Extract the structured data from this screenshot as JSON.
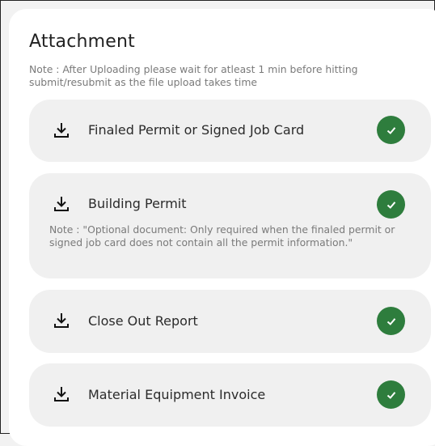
{
  "page": {
    "title": "Attachment",
    "note": "Note : After Uploading please wait for atleast 1 min before hitting submit/resubmit as the file upload takes time"
  },
  "attachments": [
    {
      "label": "Finaled Permit or Signed Job Card",
      "icon": "download-icon",
      "status_icon": "check-icon",
      "status_color": "#2e7d3d"
    },
    {
      "label": "Building Permit",
      "icon": "download-icon",
      "status_icon": "check-icon",
      "status_color": "#2e7d3d",
      "note": "Note : \"Optional document: Only required when the finaled permit or signed job card does not contain all the permit information.\""
    },
    {
      "label": "Close Out Report",
      "icon": "download-icon",
      "status_icon": "check-icon",
      "status_color": "#2e7d3d"
    },
    {
      "label": "Material Equipment Invoice",
      "icon": "download-icon",
      "status_icon": "check-icon",
      "status_color": "#2e7d3d"
    }
  ]
}
